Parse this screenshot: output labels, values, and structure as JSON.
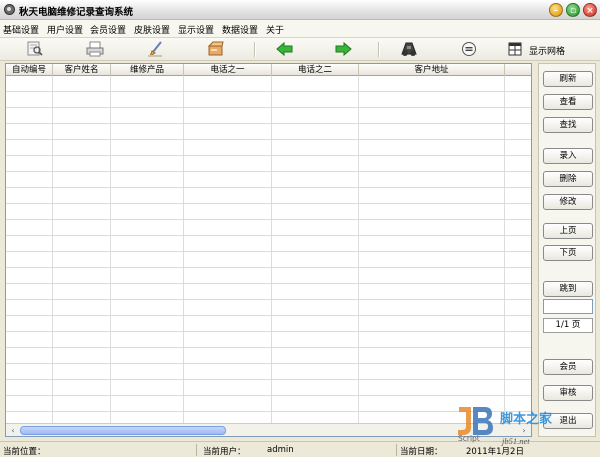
{
  "window": {
    "title": "秋天电脑维修记录查询系统"
  },
  "menu": [
    "基础设置",
    "用户设置",
    "会员设置",
    "皮肤设置",
    "显示设置",
    "数据设置",
    "关于"
  ],
  "toolbar": {
    "show_grid_label": "显示网格",
    "icons": [
      "search-doc-icon",
      "printer-icon",
      "brush-icon",
      "open-box-icon",
      "back-arrow-icon",
      "forward-arrow-icon",
      "binoculars-icon",
      "fast-forward-icon",
      "grid-icon"
    ],
    "accent_green": "#2ea62e"
  },
  "table": {
    "columns": [
      "自动编号",
      "客户姓名",
      "维修产品",
      "电话之一",
      "电话之二",
      "客户地址"
    ],
    "rows": []
  },
  "side": {
    "refresh": "刷新",
    "view": "查看",
    "find": "查找",
    "add": "录入",
    "delete": "删除",
    "edit": "修改",
    "prev_page": "上页",
    "next_page": "下页",
    "jump": "跳到",
    "page_input": "",
    "page_indicator": "1/1 页",
    "member": "会员",
    "audit": "审核",
    "exit": "退出"
  },
  "status": {
    "location_label": "当前位置：",
    "location_value": "",
    "user_label": "当前用户：",
    "user_value": "admin",
    "date_label": "当前日期：",
    "date_value": "2011年1月2日"
  },
  "watermark": {
    "brand": "脚本之家",
    "script_label": "Script",
    "url": "jb51.net"
  }
}
